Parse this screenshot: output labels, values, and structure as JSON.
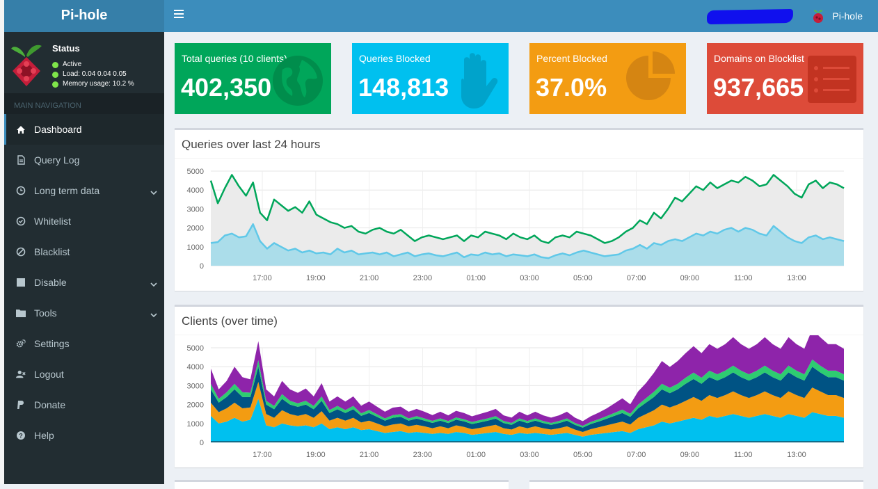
{
  "app": {
    "title": "Pi-hole"
  },
  "header": {
    "user_name": "Pi-hole"
  },
  "sidebar": {
    "status_title": "Status",
    "status_lines": [
      "Active",
      "Load:  0.04  0.04  0.05",
      "Memory usage:  10.2 %"
    ],
    "nav_header": "MAIN NAVIGATION",
    "items": [
      {
        "label": "Dashboard",
        "icon": "home-icon"
      },
      {
        "label": "Query Log",
        "icon": "file-icon"
      },
      {
        "label": "Long term data",
        "icon": "clock-icon"
      },
      {
        "label": "Whitelist",
        "icon": "check-circle-icon"
      },
      {
        "label": "Blacklist",
        "icon": "ban-icon"
      },
      {
        "label": "Disable",
        "icon": "stop-icon"
      },
      {
        "label": "Tools",
        "icon": "folder-icon"
      },
      {
        "label": "Settings",
        "icon": "gears-icon"
      },
      {
        "label": "Logout",
        "icon": "user-times-icon"
      },
      {
        "label": "Donate",
        "icon": "paypal-icon"
      },
      {
        "label": "Help",
        "icon": "question-circle-icon"
      }
    ]
  },
  "stats": [
    {
      "label": "Total queries (10 clients)",
      "value": "402,350",
      "color": "#00a65a",
      "icon": "globe-icon"
    },
    {
      "label": "Queries Blocked",
      "value": "148,813",
      "color": "#00c0ef",
      "icon": "hand-icon"
    },
    {
      "label": "Percent Blocked",
      "value": "37.0%",
      "color": "#f39c12",
      "icon": "pie-chart-icon"
    },
    {
      "label": "Domains on Blocklist",
      "value": "937,665",
      "color": "#dd4b39",
      "icon": "list-icon"
    }
  ],
  "chart_data": [
    {
      "type": "area",
      "title": "Queries over last 24 hours",
      "ylim": [
        0,
        5000
      ],
      "yticks": [
        "0",
        "1000",
        "2000",
        "3000",
        "4000",
        "5000"
      ],
      "xticks": [
        "17:00",
        "19:00",
        "21:00",
        "23:00",
        "01:00",
        "03:00",
        "05:00",
        "07:00",
        "09:00",
        "11:00",
        "13:00"
      ],
      "series": [
        {
          "color": "#00a65a",
          "values": [
            4500,
            3300,
            4100,
            4800,
            4200,
            3700,
            4400,
            2800,
            2400,
            3500,
            3200,
            2900,
            3100,
            2800,
            3400,
            2700,
            2500,
            2300,
            2200,
            2000,
            2100,
            1800,
            1700,
            1900,
            2000,
            1800,
            1700,
            1900,
            1600,
            1300,
            1500,
            1600,
            1500,
            1400,
            1500,
            1600,
            1300,
            1600,
            1500,
            1800,
            1700,
            1600,
            1400,
            1700,
            1500,
            1400,
            1600,
            1300,
            1200,
            1500,
            1600,
            1500,
            1800,
            1700,
            1600,
            1400,
            1200,
            1300,
            1500,
            1800,
            2000,
            2400,
            2200,
            2800,
            2500,
            3000,
            3600,
            3400,
            3800,
            4200,
            4000,
            4400,
            4100,
            4300,
            4500,
            4400,
            4700,
            4500,
            4200,
            4300,
            4800,
            4500,
            4200,
            3800,
            3600,
            4300,
            4500,
            4100,
            4400,
            4300,
            4100
          ]
        },
        {
          "color": "#60c8e8",
          "values": [
            1200,
            1250,
            1600,
            1700,
            1500,
            1550,
            2200,
            1300,
            900,
            1200,
            1000,
            800,
            900,
            700,
            800,
            650,
            700,
            600,
            900,
            700,
            800,
            600,
            650,
            700,
            600,
            700,
            500,
            600,
            700,
            500,
            600,
            650,
            550,
            500,
            600,
            700,
            450,
            600,
            550,
            700,
            600,
            650,
            500,
            600,
            550,
            500,
            600,
            450,
            400,
            550,
            650,
            550,
            700,
            800,
            700,
            600,
            500,
            550,
            600,
            800,
            900,
            1100,
            900,
            1200,
            1100,
            1300,
            1400,
            1300,
            1500,
            1700,
            1600,
            1800,
            1700,
            1900,
            2000,
            1800,
            2000,
            1900,
            1700,
            1600,
            2100,
            1800,
            1500,
            1300,
            1200,
            1500,
            1600,
            1400,
            1500,
            1400,
            1300
          ]
        }
      ]
    },
    {
      "type": "area",
      "title": "Clients (over time)",
      "ylim": [
        0,
        5000
      ],
      "yticks": [
        "0",
        "1000",
        "2000",
        "3000",
        "4000",
        "5000"
      ],
      "xticks": [
        "17:00",
        "19:00",
        "21:00",
        "23:00",
        "01:00",
        "03:00",
        "05:00",
        "07:00",
        "09:00",
        "11:00",
        "13:00"
      ],
      "series": [
        {
          "color": "#00c0ef",
          "values": [
            1400,
            1000,
            1100,
            1300,
            1100,
            1200,
            2300,
            900,
            800,
            1000,
            900,
            850,
            900,
            800,
            1000,
            700,
            800,
            700,
            800,
            650,
            700,
            600,
            500,
            550,
            600,
            500,
            550,
            500,
            450,
            500,
            450,
            550,
            500,
            400,
            450,
            500,
            550,
            450,
            400,
            500,
            450,
            500,
            450,
            400,
            450,
            500,
            400,
            300,
            400,
            450,
            500,
            550,
            600,
            500,
            700,
            800,
            900,
            1100,
            1000,
            1100,
            1200,
            1300,
            1200,
            1400,
            1300,
            1400,
            1500,
            1400,
            1300,
            1400,
            1500,
            1400,
            1300,
            1500,
            1400,
            1300,
            1600,
            1500,
            1400,
            1400,
            1300
          ]
        },
        {
          "color": "#f39c12",
          "values": [
            700,
            600,
            700,
            800,
            700,
            650,
            900,
            600,
            500,
            700,
            600,
            550,
            600,
            500,
            650,
            450,
            500,
            450,
            500,
            400,
            450,
            400,
            350,
            400,
            400,
            350,
            380,
            350,
            300,
            350,
            300,
            350,
            320,
            300,
            320,
            350,
            380,
            300,
            280,
            350,
            300,
            350,
            300,
            280,
            300,
            350,
            280,
            250,
            300,
            350,
            400,
            450,
            500,
            450,
            600,
            700,
            800,
            900,
            850,
            900,
            1000,
            1100,
            1000,
            1100,
            1050,
            1100,
            1200,
            1100,
            1050,
            1100,
            1200,
            1100,
            1050,
            1200,
            1100,
            1050,
            1300,
            1200,
            1100,
            1100,
            1050
          ]
        },
        {
          "color": "#005384",
          "values": [
            700,
            500,
            600,
            700,
            600,
            550,
            800,
            500,
            450,
            600,
            500,
            480,
            500,
            450,
            550,
            400,
            450,
            400,
            450,
            350,
            400,
            350,
            300,
            350,
            350,
            300,
            330,
            300,
            280,
            300,
            270,
            300,
            290,
            270,
            290,
            300,
            330,
            270,
            250,
            300,
            270,
            300,
            270,
            250,
            270,
            300,
            250,
            230,
            270,
            300,
            350,
            400,
            450,
            400,
            500,
            600,
            700,
            800,
            750,
            800,
            900,
            950,
            900,
            950,
            920,
            950,
            1000,
            950,
            920,
            950,
            1000,
            950,
            920,
            1000,
            950,
            920,
            1100,
            1000,
            950,
            950,
            920
          ]
        },
        {
          "color": "#2ecc71",
          "values": [
            300,
            200,
            250,
            300,
            250,
            230,
            350,
            200,
            180,
            250,
            200,
            190,
            200,
            180,
            230,
            160,
            180,
            160,
            180,
            140,
            160,
            140,
            120,
            140,
            140,
            120,
            130,
            120,
            110,
            120,
            110,
            120,
            115,
            110,
            115,
            120,
            130,
            110,
            100,
            120,
            110,
            120,
            110,
            100,
            110,
            120,
            100,
            90,
            110,
            120,
            140,
            160,
            180,
            160,
            200,
            240,
            280,
            300,
            290,
            300,
            320,
            340,
            320,
            340,
            330,
            340,
            360,
            340,
            330,
            340,
            360,
            340,
            330,
            360,
            340,
            330,
            380,
            360,
            340,
            340,
            330
          ]
        },
        {
          "color": "#8e24aa",
          "values": [
            800,
            500,
            600,
            900,
            800,
            700,
            1000,
            600,
            500,
            700,
            600,
            550,
            650,
            500,
            700,
            450,
            500,
            450,
            500,
            400,
            450,
            400,
            350,
            400,
            400,
            350,
            380,
            350,
            300,
            350,
            300,
            350,
            330,
            300,
            330,
            350,
            380,
            300,
            280,
            350,
            300,
            350,
            300,
            280,
            300,
            350,
            280,
            250,
            300,
            350,
            400,
            500,
            600,
            500,
            700,
            800,
            1000,
            1200,
            1100,
            1200,
            1300,
            1400,
            1300,
            1400,
            1350,
            1400,
            1500,
            1400,
            1350,
            1400,
            1500,
            1400,
            1350,
            1500,
            1400,
            1350,
            1600,
            1500,
            1400,
            1400,
            1350
          ]
        }
      ]
    }
  ]
}
